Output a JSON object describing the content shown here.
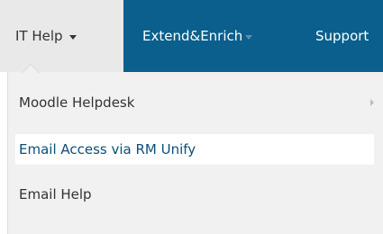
{
  "navbar": {
    "items": [
      {
        "label": "IT Help",
        "active": true
      },
      {
        "label": "Extend&Enrich",
        "active": false
      },
      {
        "label": "Support",
        "active": false
      }
    ]
  },
  "dropdown": {
    "items": [
      {
        "label": "Moodle Helpdesk",
        "has_submenu": true
      },
      {
        "label": "Email Access via RM Unify",
        "highlighted": true
      },
      {
        "label": "Email Help"
      }
    ]
  },
  "colors": {
    "navbar_bg": "#0a5f8c",
    "active_tab_bg": "#e9e9e9",
    "dropdown_bg": "#f1f1f1",
    "highlight_text": "#0a4f7a"
  }
}
